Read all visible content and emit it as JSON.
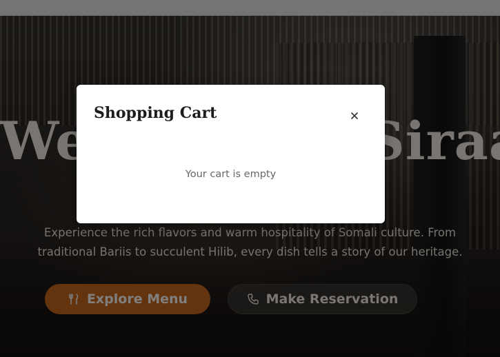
{
  "hero": {
    "title": "Welcome to Siraad Cafe Ware",
    "subtitle": "Experience the rich flavors and warm hospitality of Somali culture. From traditional Bariis to succulent Hilib, every dish tells a story of our heritage.",
    "buttons": {
      "explore": {
        "label": "Explore Menu",
        "icon": "utensils-icon"
      },
      "reserve": {
        "label": "Make Reservation",
        "icon": "phone-icon"
      }
    }
  },
  "cart_modal": {
    "title": "Shopping Cart",
    "close_icon": "close-icon",
    "empty_message": "Your cart is empty"
  },
  "colors": {
    "accent": "#c8681f",
    "modal_bg": "#ffffff",
    "overlay": "rgba(0,0,0,0.5)"
  }
}
